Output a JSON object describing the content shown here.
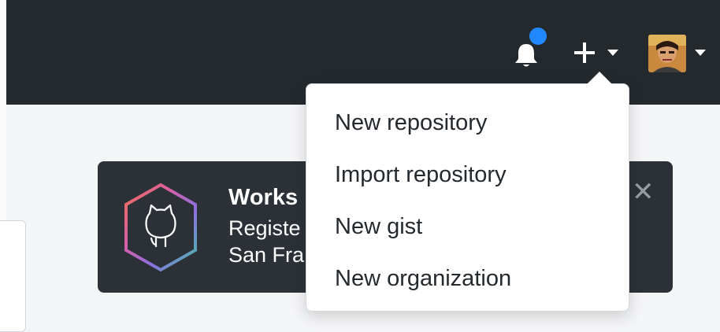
{
  "header": {
    "notification_icon": "bell-icon",
    "notification_dot_color": "#2188ff",
    "create_icon": "plus-icon",
    "create_caret_icon": "caret-down-icon",
    "avatar_caret_icon": "caret-down-icon",
    "background_color": "#24292e"
  },
  "dropdown": {
    "items": [
      {
        "label": "New repository"
      },
      {
        "label": "Import repository"
      },
      {
        "label": "New gist"
      },
      {
        "label": "New organization"
      }
    ]
  },
  "banner": {
    "title": "Works",
    "line1": "Registe",
    "line2": "San Fra",
    "close_icon": "close-icon",
    "logo_icon": "octocat-hexagon-icon",
    "background_color": "#2b3137"
  }
}
